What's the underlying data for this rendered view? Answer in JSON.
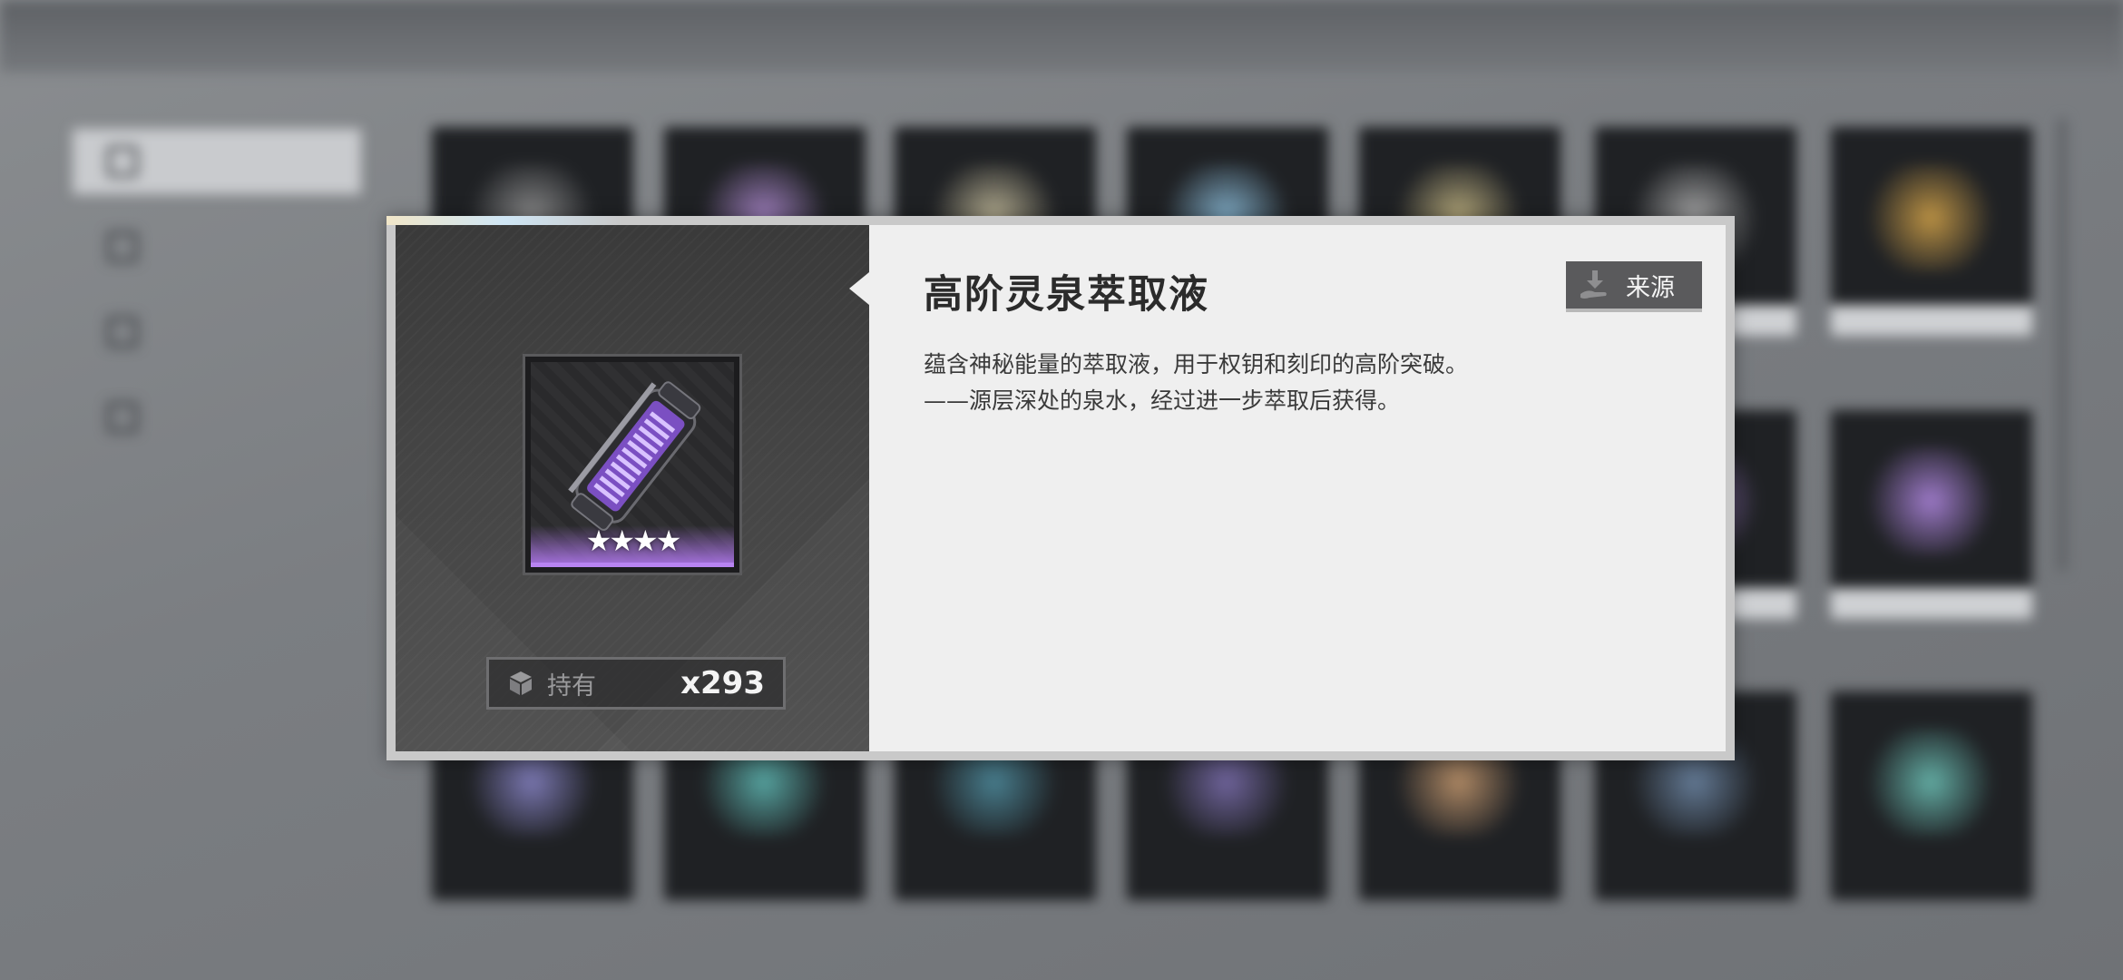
{
  "background": {
    "sidebar": [
      {
        "label": "",
        "active": true
      },
      {
        "label": "",
        "active": false
      },
      {
        "label": "",
        "active": false
      },
      {
        "label": "",
        "active": false
      }
    ],
    "cards": [
      {
        "glow": "#9a9a9a"
      },
      {
        "glow": "#b58fd8"
      },
      {
        "glow": "#cfc6a4"
      },
      {
        "glow": "#93c7e6"
      },
      {
        "glow": "#cfc08a"
      },
      {
        "glow": "#bcbcbc"
      },
      {
        "glow": "#d7a64a"
      },
      {
        "glow": "#a37fd0"
      },
      {
        "glow": "#b48ae6"
      },
      {
        "glow": "#8a86c9"
      },
      {
        "glow": "#5fb9b4"
      },
      {
        "glow": "#4f8ea0"
      },
      {
        "glow": "#7d6fb0"
      },
      {
        "glow": "#c79a6f"
      },
      {
        "glow": "#6f89a8"
      },
      {
        "glow": "#6fc5ba"
      }
    ]
  },
  "dialog": {
    "item": {
      "name": "高阶灵泉萃取液",
      "rarity_stars": "★★★★",
      "rarity_color": "#b884f2",
      "icon": "purple-canister-icon"
    },
    "owned": {
      "label": "持有",
      "count": "x293",
      "icon": "cube-icon"
    },
    "source_button": {
      "label": "来源",
      "icon": "download-hand-icon"
    },
    "description": {
      "line1": "蕴含神秘能量的萃取液，用于权钥和刻印的高阶突破。",
      "line2": "——源层深处的泉水，经过进一步萃取后获得。"
    }
  }
}
